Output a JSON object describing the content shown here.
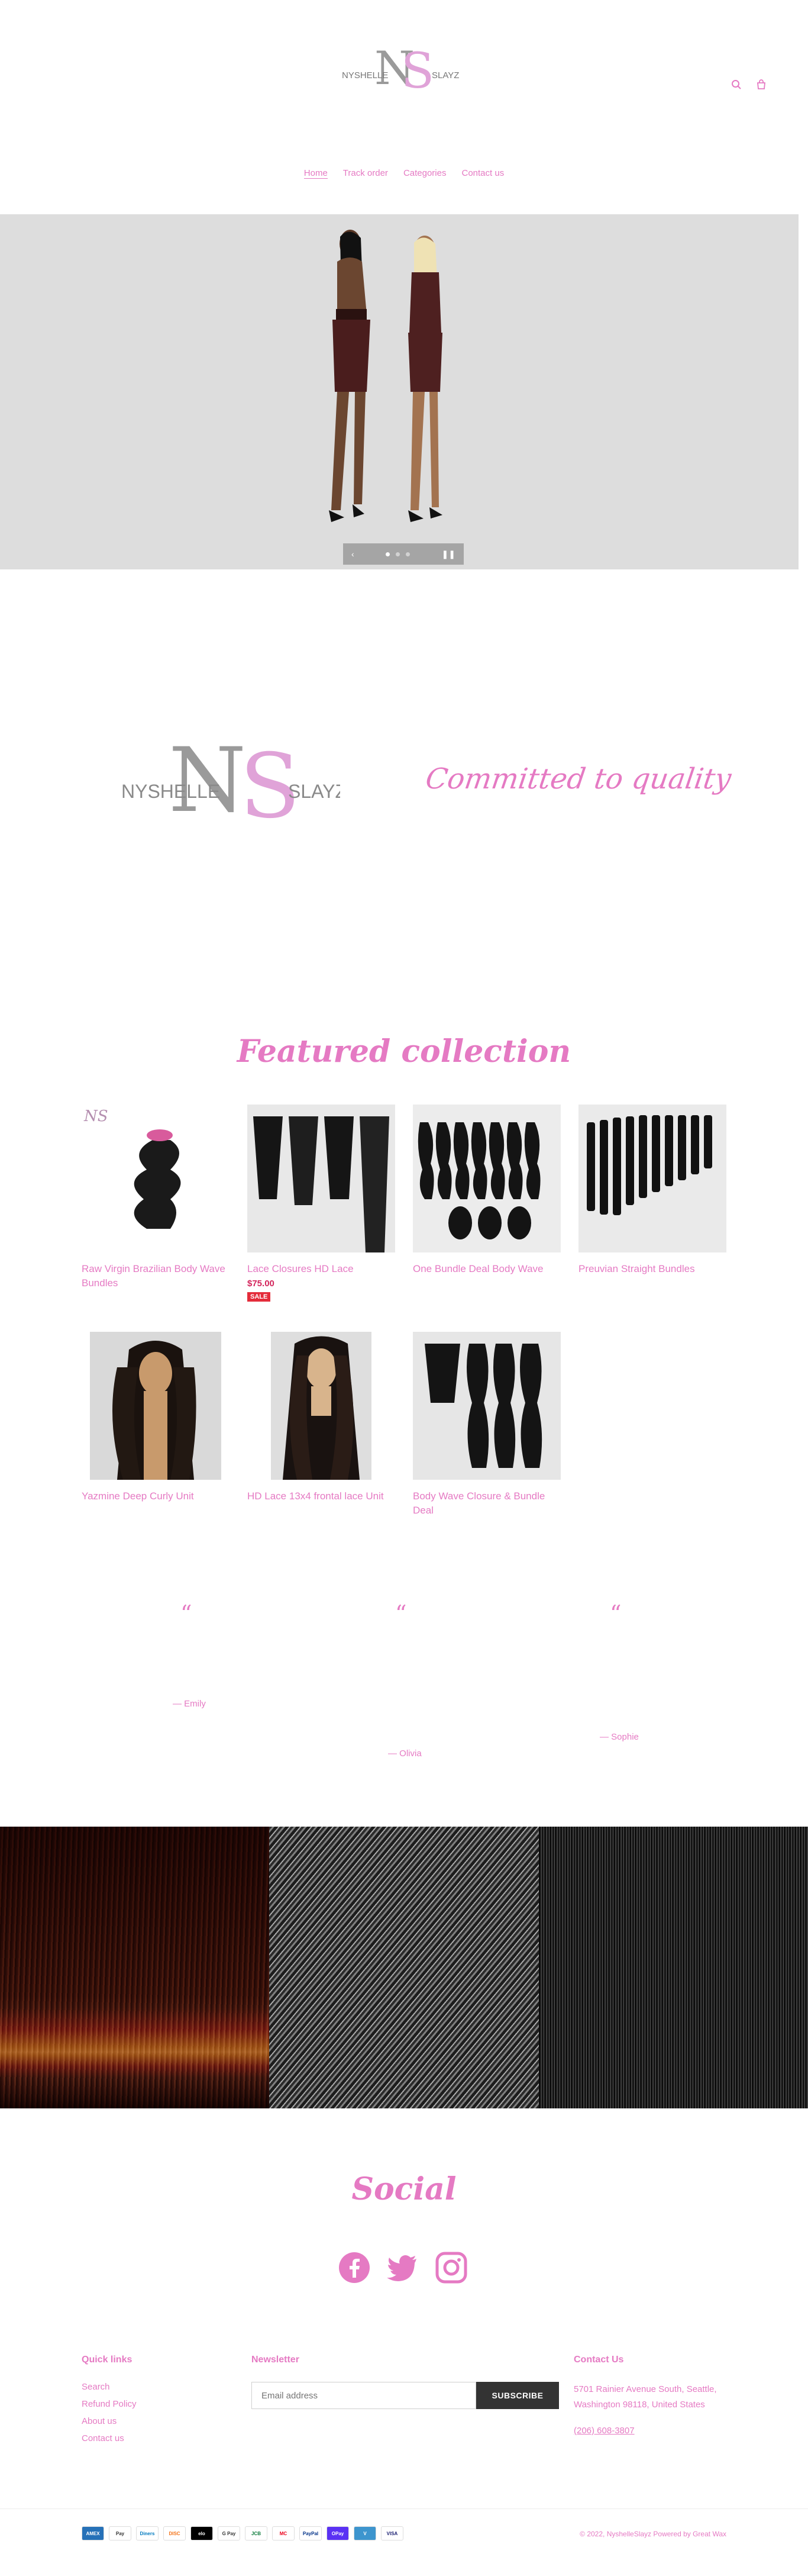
{
  "brand": {
    "name": "NYSHELLE SLAYZ",
    "logo_letters": "NS",
    "left_word": "NYSHELLE",
    "right_word": "SLAYZ",
    "tagline": "Committed to quality"
  },
  "nav": [
    "Home",
    "Track order",
    "Categories",
    "Contact us"
  ],
  "hero": {
    "prev": "‹",
    "next": "❚❚"
  },
  "featured": {
    "title": "Featured collection",
    "products": [
      {
        "title": "Raw Virgin Brazilian Body Wave Bundles",
        "price": "",
        "sale": ""
      },
      {
        "title": "Lace Closures HD Lace",
        "price": "$75.00",
        "sale": "SALE"
      },
      {
        "title": "One Bundle Deal Body Wave",
        "price": "",
        "sale": ""
      },
      {
        "title": "Preuvian Straight Bundles",
        "price": "",
        "sale": ""
      },
      {
        "title": "Yazmine Deep Curly Unit",
        "price": "",
        "sale": ""
      },
      {
        "title": "HD Lace 13x4 frontal lace Unit",
        "price": "",
        "sale": ""
      },
      {
        "title": "Body Wave Closure & Bundle Deal",
        "price": "",
        "sale": ""
      }
    ]
  },
  "testimonials": [
    {
      "quote_mark": "“",
      "author": "— Emily"
    },
    {
      "quote_mark": "“",
      "author": "— Olivia"
    },
    {
      "quote_mark": "“",
      "author": "— Sophie"
    }
  ],
  "social": {
    "title": "Social",
    "icons": [
      "facebook-icon",
      "twitter-icon",
      "instagram-icon"
    ]
  },
  "footer": {
    "quick_links_title": "Quick links",
    "quick_links": [
      "Search",
      "Refund Policy",
      "About us",
      "Contact us"
    ],
    "newsletter_title": "Newsletter",
    "email_placeholder": "Email address",
    "subscribe": "SUBSCRIBE",
    "contact_title": "Contact Us",
    "address": "5701 Rainier Avenue South, Seattle, Washington 98118, United States",
    "phone": "(206) 608-3807",
    "payment_icons": [
      "AMEX",
      "Pay",
      "Diners",
      "DISC",
      "elo",
      "G Pay",
      "JCB",
      "MC",
      "PayPal",
      "OPay",
      "V",
      "VISA"
    ],
    "copyright": "© 2022, NyshelleSlayz Powered by Great Wax"
  },
  "colors": {
    "accent": "#e57ac3",
    "sale": "#e42c3a",
    "dark": "#333333"
  }
}
